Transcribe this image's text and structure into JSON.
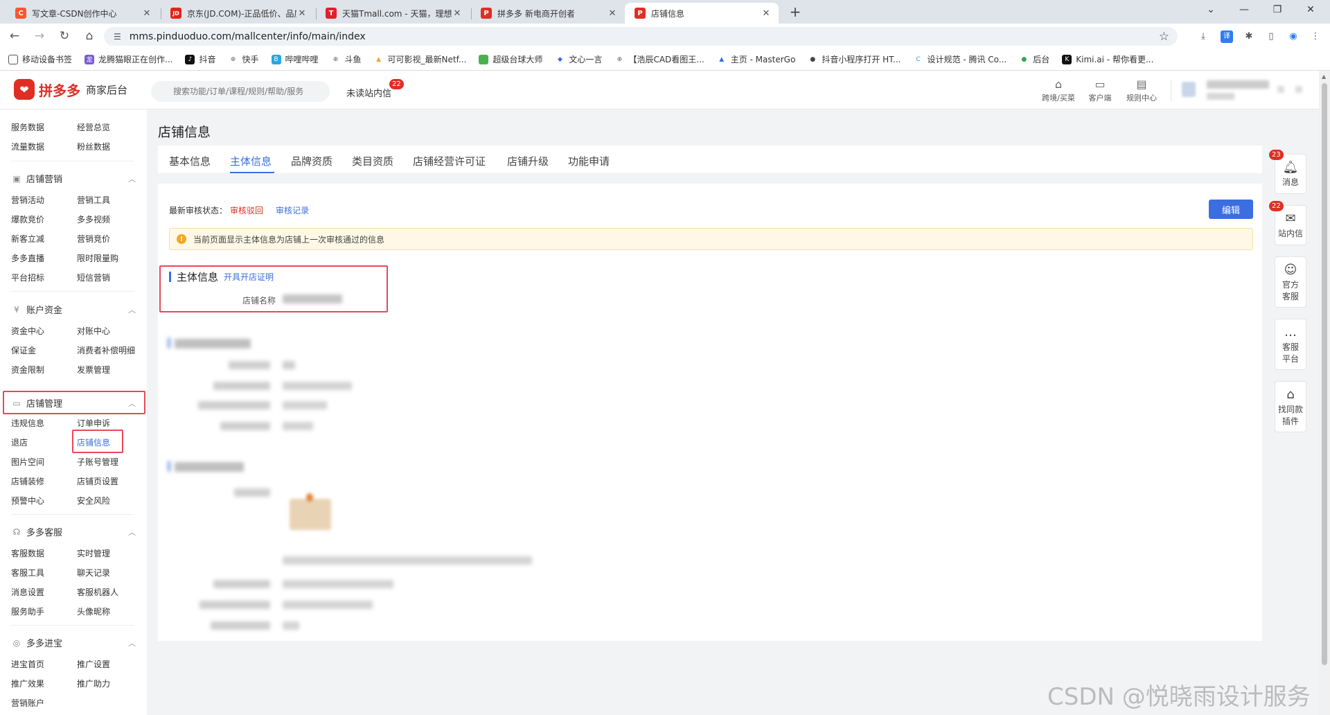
{
  "browser": {
    "tabs": [
      {
        "title": "写文章-CSDN创作中心",
        "icon": "C",
        "color": "#fc5531"
      },
      {
        "title": "京东(JD.COM)-正品低价、品质保障",
        "icon": "JD",
        "color": "#e1251b"
      },
      {
        "title": "天猫Tmall.com - 天猫，理想生活上天猫",
        "icon": "T",
        "color": "#e61e2b"
      },
      {
        "title": "拼多多 新电商开创者",
        "icon": "P",
        "color": "#e02e24"
      },
      {
        "title": "店铺信息",
        "icon": "P",
        "color": "#e02e24"
      }
    ],
    "url": "mms.pinduoduo.com/mallcenter/info/main/index",
    "bookmarks": [
      {
        "label": "移动设备书签",
        "icon": "□",
        "color": "#666"
      },
      {
        "label": "龙腾猫眼正在创作...",
        "icon": "龙",
        "color": "#7b5cd6"
      },
      {
        "label": "抖音",
        "icon": "♪",
        "color": "#111"
      },
      {
        "label": "快手",
        "icon": "⊕",
        "color": "#666"
      },
      {
        "label": "哔哩哔哩",
        "icon": "B",
        "color": "#2aa6e0"
      },
      {
        "label": "斗鱼",
        "icon": "⊕",
        "color": "#666"
      },
      {
        "label": "可可影视_最新Netf...",
        "icon": "▲",
        "color": "#f5a623"
      },
      {
        "label": "超级台球大师",
        "icon": "■",
        "color": "#4caf50"
      },
      {
        "label": "文心一言",
        "icon": "◆",
        "color": "#2f6fe4"
      },
      {
        "label": "【浩辰CAD看图王...",
        "icon": "⊕",
        "color": "#666"
      },
      {
        "label": "主页 - MasterGo",
        "icon": "▲",
        "color": "#2f6fe4"
      },
      {
        "label": "抖音小程序打开 HT...",
        "icon": "●",
        "color": "#444"
      },
      {
        "label": "设计规范 - 腾讯 Co...",
        "icon": "C",
        "color": "#2f9cf0"
      },
      {
        "label": "后台",
        "icon": "●",
        "color": "#2fa84f"
      },
      {
        "label": "Kimi.ai - 帮你看更...",
        "icon": "K",
        "color": "#111"
      }
    ]
  },
  "header": {
    "logo_text": "拼多多",
    "logo_sub": "商家后台",
    "search_placeholder": "搜索功能/订单/课程/规则/帮助/服务",
    "unread_label": "未读站内信",
    "unread_count": "22",
    "tools": [
      {
        "label": "跨境/买菜",
        "icon": "⌂"
      },
      {
        "label": "客户端",
        "icon": "▭"
      },
      {
        "label": "规则中心",
        "icon": "▤"
      }
    ]
  },
  "sidebar": {
    "top_items": [
      "服务数据",
      "经营总览",
      "流量数据",
      "粉丝数据"
    ],
    "groups": [
      {
        "title": "店铺营销",
        "icon": "▣",
        "items": [
          "营销活动",
          "营销工具",
          "爆款竞价",
          "多多视频",
          "新客立减",
          "营销竞价",
          "多多直播",
          "限时限量购",
          "平台招标",
          "短信营销"
        ]
      },
      {
        "title": "账户资金",
        "icon": "¥",
        "items": [
          "资金中心",
          "对账中心",
          "保证金",
          "消费者补偿明细",
          "资金限制",
          "发票管理"
        ]
      },
      {
        "title": "店铺管理",
        "icon": "▭",
        "items": [
          "违规信息",
          "订单申诉",
          "退店",
          "店铺信息",
          "图片空间",
          "子账号管理",
          "店铺装修",
          "店铺页设置",
          "预警中心",
          "安全风险"
        ]
      },
      {
        "title": "多多客服",
        "icon": "☊",
        "items": [
          "客服数据",
          "实时管理",
          "客服工具",
          "聊天记录",
          "消息设置",
          "客服机器人",
          "服务助手",
          "头像昵称"
        ]
      },
      {
        "title": "多多进宝",
        "icon": "◎",
        "items": [
          "进宝首页",
          "推广设置",
          "推广效果",
          "推广助力",
          "营销账户"
        ]
      }
    ]
  },
  "main": {
    "page_title": "店铺信息",
    "tabs": [
      "基本信息",
      "主体信息",
      "品牌资质",
      "类目资质",
      "店铺经营许可证",
      "店铺升级",
      "功能申请"
    ],
    "active_tab": "主体信息",
    "audit_label": "最新审核状态：",
    "audit_status": "审核驳回",
    "audit_record": "审核记录",
    "edit_button": "编辑",
    "notice": "当前页面显示主体信息为店铺上一次审核通过的信息",
    "section_title": "主体信息",
    "section_link": "开具开店证明",
    "store_name_label": "店铺名称"
  },
  "right_float": [
    {
      "label": "消息",
      "icon": "🔔",
      "badge": "23"
    },
    {
      "label": "站内信",
      "icon": "✉",
      "badge": "22"
    },
    {
      "label": "官方客服",
      "icon": "☺",
      "badge": ""
    },
    {
      "label": "客服平台",
      "icon": "…",
      "badge": ""
    },
    {
      "label": "找同款插件",
      "icon": "⌂",
      "badge": ""
    }
  ],
  "watermark": "CSDN @悦晓雨设计服务",
  "colors": {
    "brand": "#e02e24",
    "primary": "#3b6ee0",
    "highlight": "#e8485a"
  }
}
